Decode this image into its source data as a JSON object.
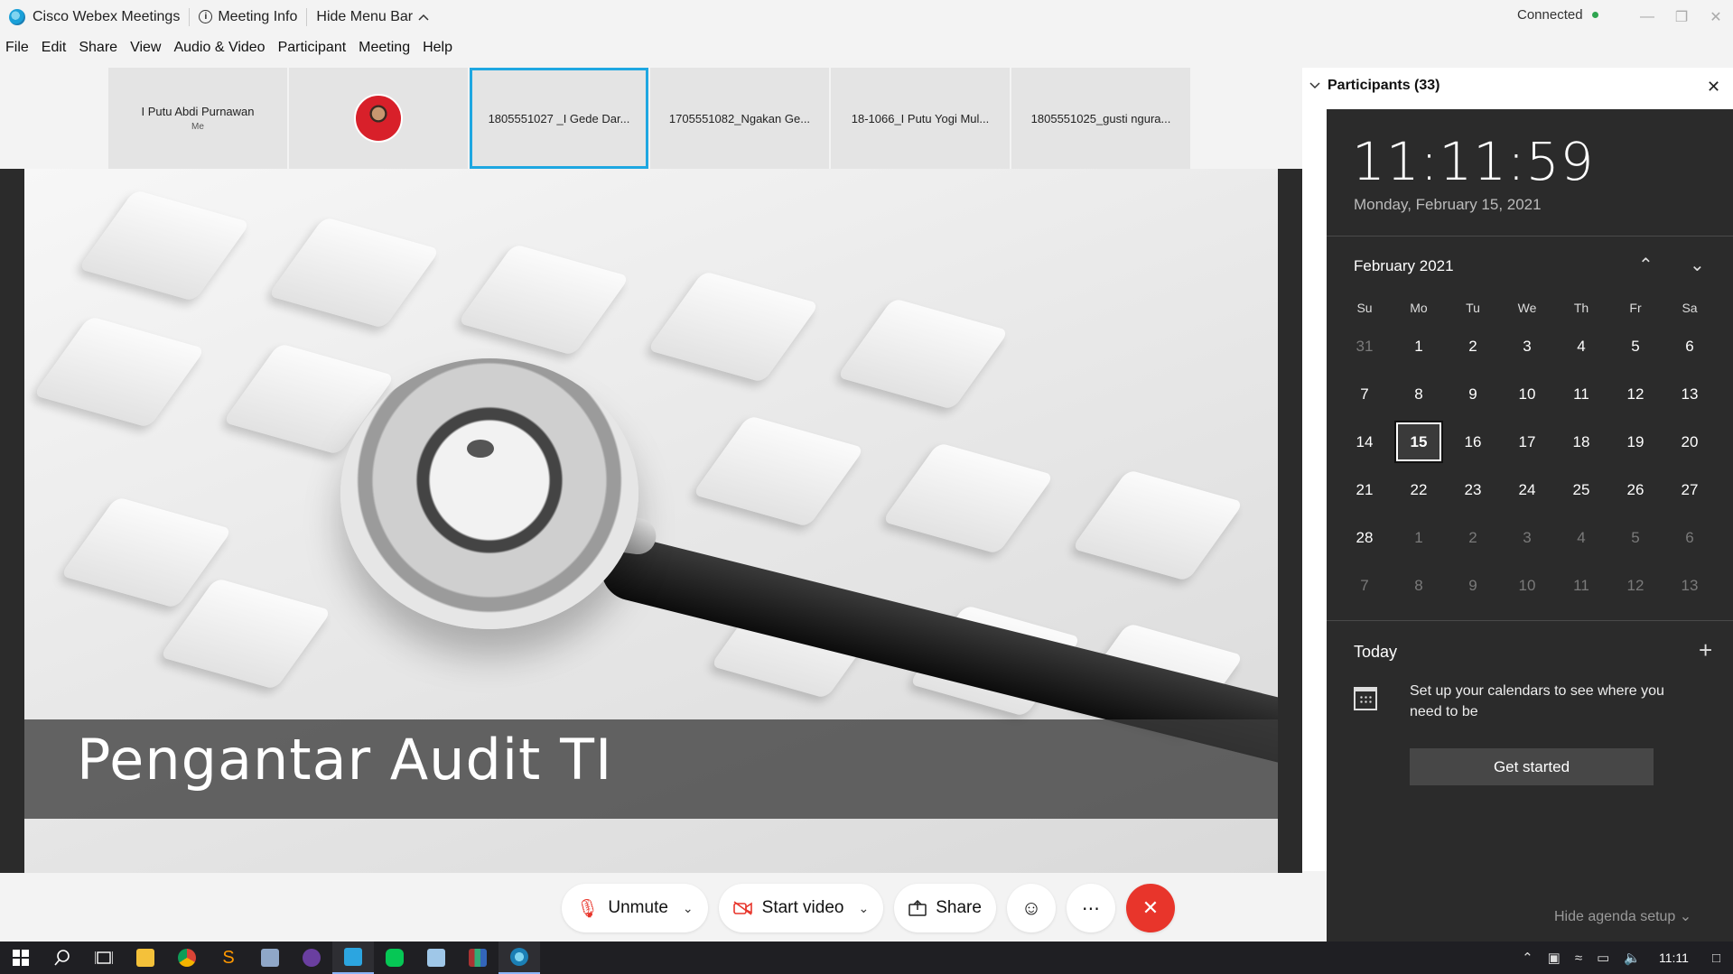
{
  "window": {
    "app_title": "Cisco Webex Meetings",
    "meeting_info": "Meeting Info",
    "hide_menu_bar": "Hide Menu Bar",
    "connection_status": "Connected",
    "status_color": "#2ea44f"
  },
  "menu": [
    "File",
    "Edit",
    "Share",
    "View",
    "Audio & Video",
    "Participant",
    "Meeting",
    "Help"
  ],
  "thumbnails": [
    {
      "name": "I Putu Abdi Purnawan",
      "sub": "Me"
    },
    {
      "name": "",
      "sub": ""
    },
    {
      "name": "1805551027 _I Gede Dar...",
      "sub": ""
    },
    {
      "name": "1705551082_Ngakan Ge...",
      "sub": ""
    },
    {
      "name": "18-1066_I Putu Yogi Mul...",
      "sub": ""
    },
    {
      "name": "1805551025_gusti ngura...",
      "sub": ""
    }
  ],
  "slide": {
    "title": "Pengantar Audit TI"
  },
  "participants_panel": {
    "title": "Participants (33)"
  },
  "controls": {
    "unmute": "Unmute",
    "start_video": "Start video",
    "share": "Share",
    "end_color": "#e8352b"
  },
  "calendar_flyout": {
    "clock": "11:11:59",
    "date": "Monday, February 15, 2021",
    "month": "February 2021",
    "weekdays": [
      "Su",
      "Mo",
      "Tu",
      "We",
      "Th",
      "Fr",
      "Sa"
    ],
    "days": [
      {
        "d": "31",
        "muted": true
      },
      {
        "d": "1"
      },
      {
        "d": "2"
      },
      {
        "d": "3"
      },
      {
        "d": "4"
      },
      {
        "d": "5"
      },
      {
        "d": "6"
      },
      {
        "d": "7"
      },
      {
        "d": "8"
      },
      {
        "d": "9"
      },
      {
        "d": "10"
      },
      {
        "d": "11"
      },
      {
        "d": "12"
      },
      {
        "d": "13"
      },
      {
        "d": "14"
      },
      {
        "d": "15",
        "today": true
      },
      {
        "d": "16"
      },
      {
        "d": "17"
      },
      {
        "d": "18"
      },
      {
        "d": "19"
      },
      {
        "d": "20"
      },
      {
        "d": "21"
      },
      {
        "d": "22"
      },
      {
        "d": "23"
      },
      {
        "d": "24"
      },
      {
        "d": "25"
      },
      {
        "d": "26"
      },
      {
        "d": "27"
      },
      {
        "d": "28"
      },
      {
        "d": "1",
        "muted": true
      },
      {
        "d": "2",
        "muted": true
      },
      {
        "d": "3",
        "muted": true
      },
      {
        "d": "4",
        "muted": true
      },
      {
        "d": "5",
        "muted": true
      },
      {
        "d": "6",
        "muted": true
      },
      {
        "d": "7",
        "muted": true
      },
      {
        "d": "8",
        "muted": true
      },
      {
        "d": "9",
        "muted": true
      },
      {
        "d": "10",
        "muted": true
      },
      {
        "d": "11",
        "muted": true
      },
      {
        "d": "12",
        "muted": true
      },
      {
        "d": "13",
        "muted": true
      }
    ],
    "today_label": "Today",
    "agenda_message": "Set up your calendars to see where you need to be",
    "get_started": "Get started",
    "hide_agenda": "Hide agenda setup"
  },
  "taskbar": {
    "time": "11:11",
    "apps": [
      "start-icon",
      "search-icon",
      "task-view-icon",
      "file-explorer-icon",
      "chrome-icon",
      "sublime-icon",
      "app-icon",
      "app-icon-2",
      "telegram-icon",
      "line-icon",
      "notepad-icon",
      "winrar-icon",
      "webex-icon"
    ]
  }
}
